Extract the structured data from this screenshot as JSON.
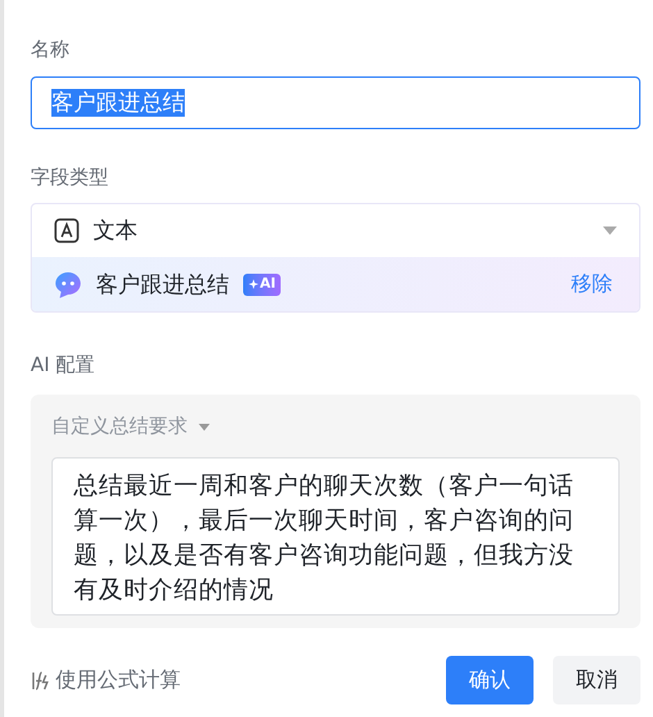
{
  "name_field": {
    "label": "名称",
    "value": "客户跟进总结",
    "text_selected": true
  },
  "field_type": {
    "label": "字段类型",
    "type": "文本",
    "ai_template": {
      "name": "客户跟进总结",
      "badge": "AI",
      "remove": "移除"
    }
  },
  "ai_config": {
    "label": "AI 配置",
    "prompt_type": "自定义总结要求",
    "prompt": "总结最近一周和客户的聊天次数（客户一句话算一次），最后一次聊天时间，客户咨询的问题，以及是否有客户咨询功能问题，但我方没有及时介绍的情况"
  },
  "footer": {
    "formula": "使用公式计算",
    "buttons": [
      {
        "label": "确认",
        "kind": "primary"
      },
      {
        "label": "取消",
        "kind": "secondary"
      }
    ]
  }
}
